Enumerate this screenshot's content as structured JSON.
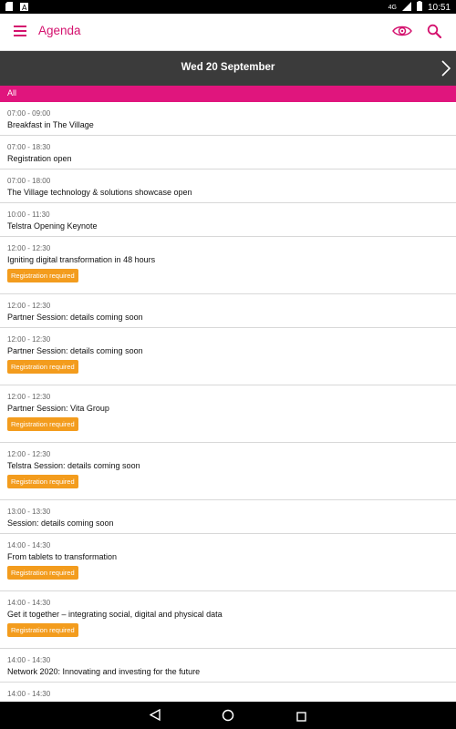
{
  "statusbar": {
    "time": "10:51",
    "network": "4G",
    "left_icons": [
      "sd-card-icon",
      "notification-a-icon"
    ],
    "right_icons": [
      "signal-icon",
      "battery-icon"
    ]
  },
  "appbar": {
    "title": "Agenda",
    "accent": "#d4116e"
  },
  "datebar": {
    "date": "Wed 20 September"
  },
  "filter": {
    "label": "All",
    "color": "#e0157d"
  },
  "badge_color": "#f39c1d",
  "items": [
    {
      "time": "07:00 - 09:00",
      "title": "Breakfast in The Village",
      "badge": ""
    },
    {
      "time": "07:00 - 18:30",
      "title": "Registration open",
      "badge": ""
    },
    {
      "time": "07:00 - 18:00",
      "title": "The Village technology & solutions showcase open",
      "badge": ""
    },
    {
      "time": "10:00 - 11:30",
      "title": "Telstra Opening Keynote",
      "badge": ""
    },
    {
      "time": "12:00 - 12:30",
      "title": "Igniting digital transformation in 48 hours",
      "badge": "Registration required"
    },
    {
      "time": "12:00 - 12:30",
      "title": "Partner Session: details coming soon",
      "badge": ""
    },
    {
      "time": "12:00 - 12:30",
      "title": "Partner Session: details coming soon",
      "badge": "Registration required"
    },
    {
      "time": "12:00 - 12:30",
      "title": "Partner Session: Vita Group",
      "badge": "Registration required"
    },
    {
      "time": "12:00 - 12:30",
      "title": "Telstra Session: details coming soon",
      "badge": "Registration required"
    },
    {
      "time": "13:00 - 13:30",
      "title": "Session: details coming soon",
      "badge": ""
    },
    {
      "time": "14:00 - 14:30",
      "title": "From tablets to transformation",
      "badge": "Registration required"
    },
    {
      "time": "14:00 - 14:30",
      "title": "Get it together – integrating social, digital and physical data",
      "badge": "Registration required"
    },
    {
      "time": "14:00 - 14:30",
      "title": "Network 2020: Innovating and investing for the future",
      "badge": ""
    },
    {
      "time": "14:00 - 14:30",
      "title": "",
      "badge": ""
    }
  ]
}
